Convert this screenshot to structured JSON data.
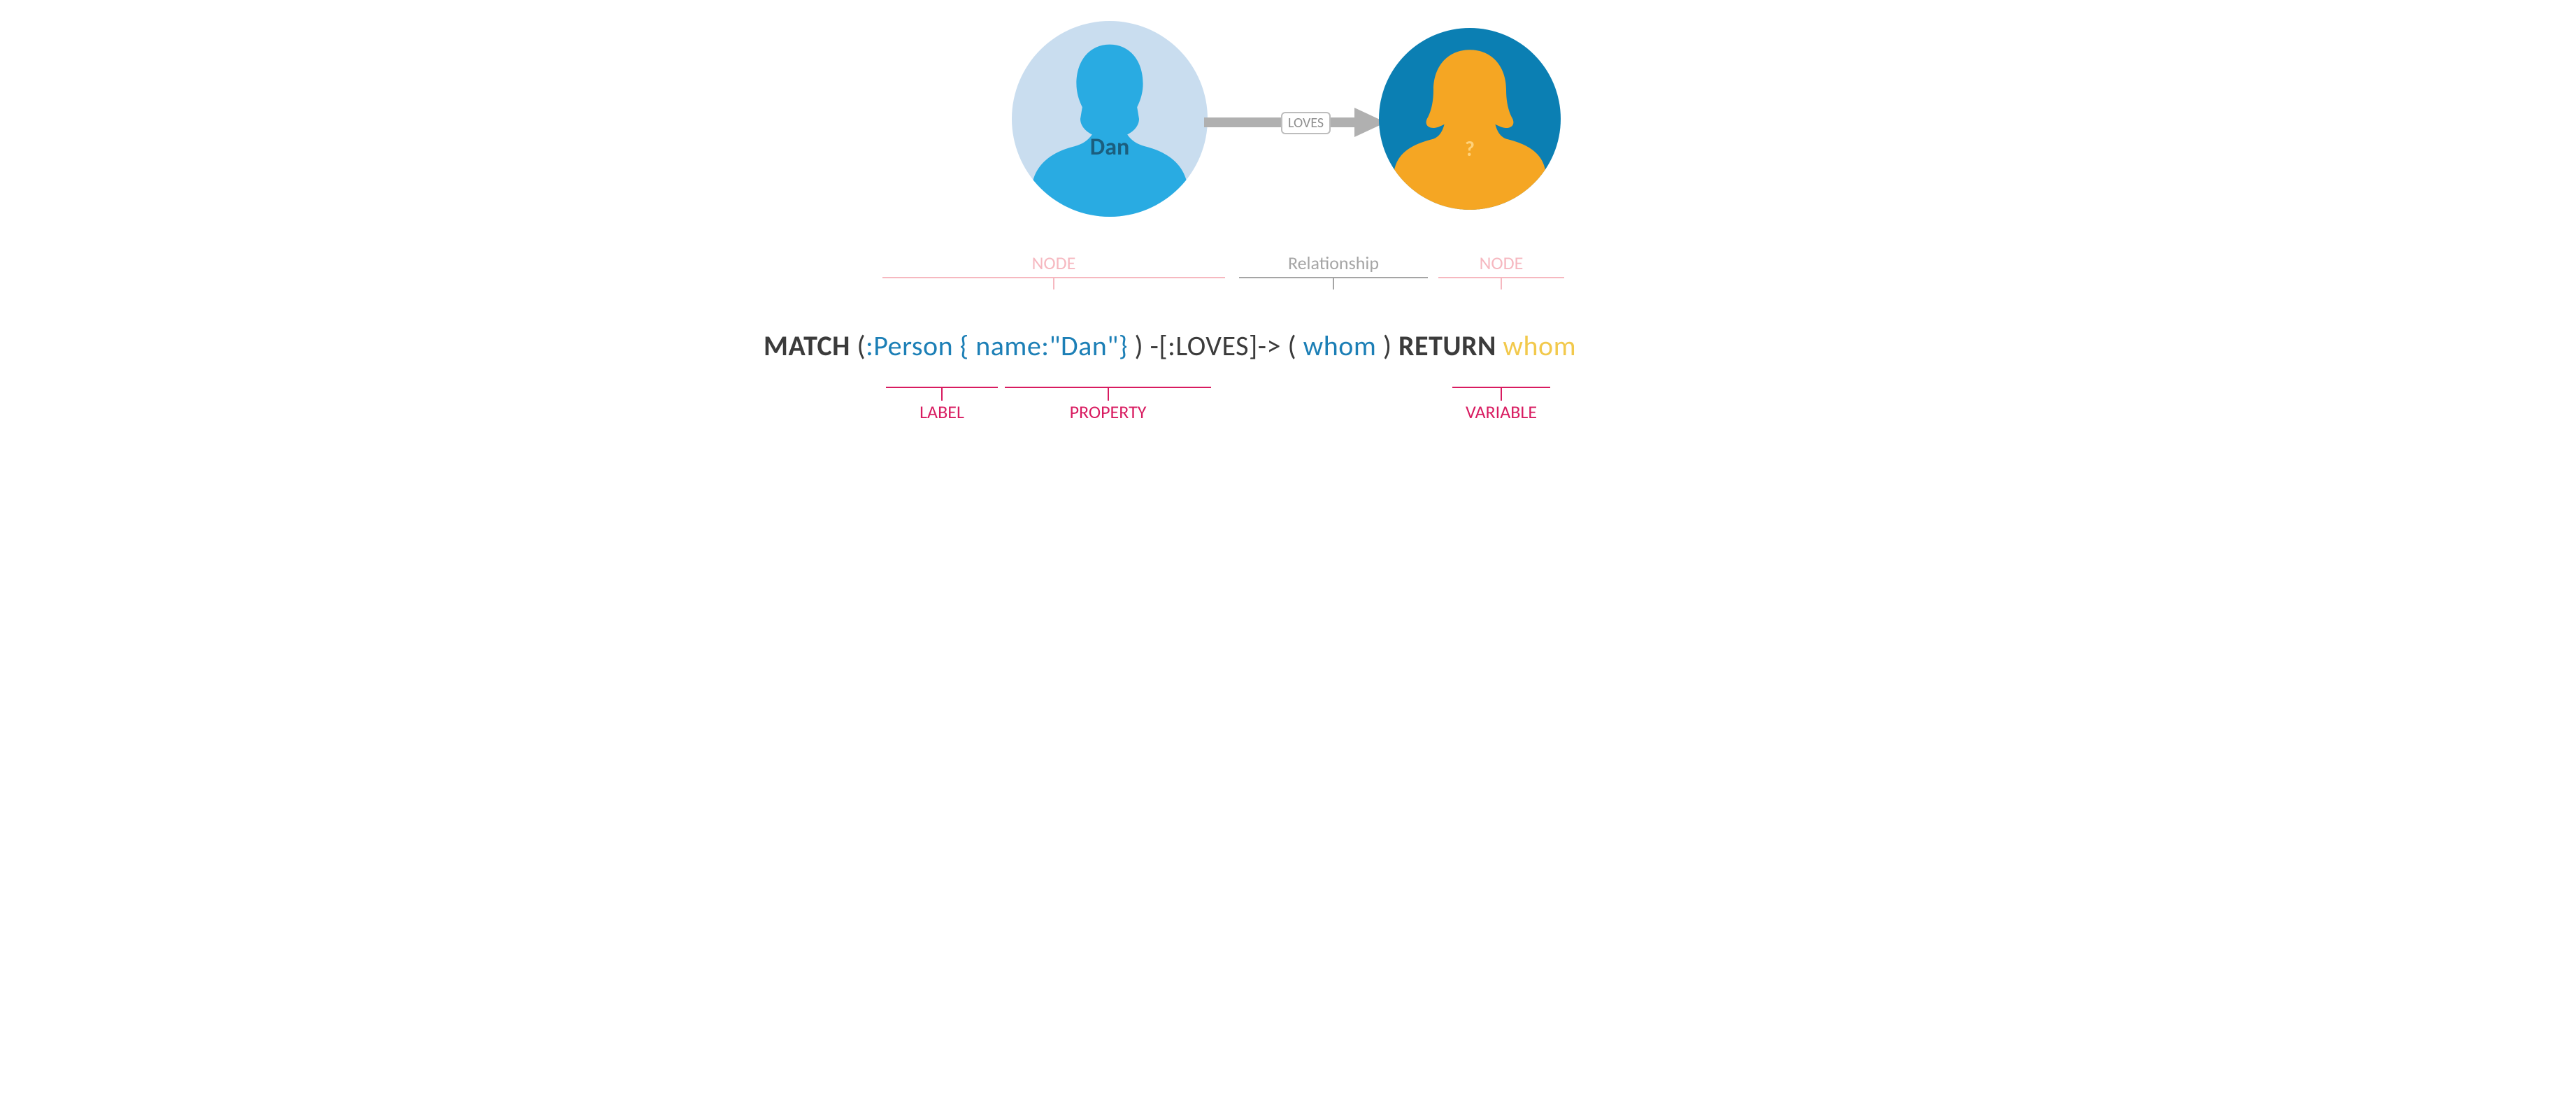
{
  "diagram": {
    "left_node": {
      "name": "Dan",
      "circle_fill": "#c9ddef",
      "silhouette_fill": "#29abe2",
      "label_color": "#1b5e7e"
    },
    "relationship_arrow": {
      "label": "LOVES"
    },
    "right_node": {
      "name": "?",
      "circle_fill": "#0b7fb3",
      "silhouette_fill": "#f5a623",
      "label_color": "#ffd27a"
    }
  },
  "annotations": {
    "top": {
      "node_left": "NODE",
      "relationship": "Relationship",
      "node_right": "NODE"
    },
    "bottom": {
      "label": "LABEL",
      "property": "PROPERTY",
      "variable": "VARIABLE"
    }
  },
  "query": {
    "match": "MATCH ",
    "open_paren_1": "(",
    "label": ":Person ",
    "property": "{ name:\"Dan\"} ",
    "close_paren_1": ") ",
    "rel": "-[:LOVES]-> ",
    "open_paren_2": "( ",
    "variable": "whom ",
    "close_paren_2": ") ",
    "return": "RETURN ",
    "return_var": "whom"
  }
}
